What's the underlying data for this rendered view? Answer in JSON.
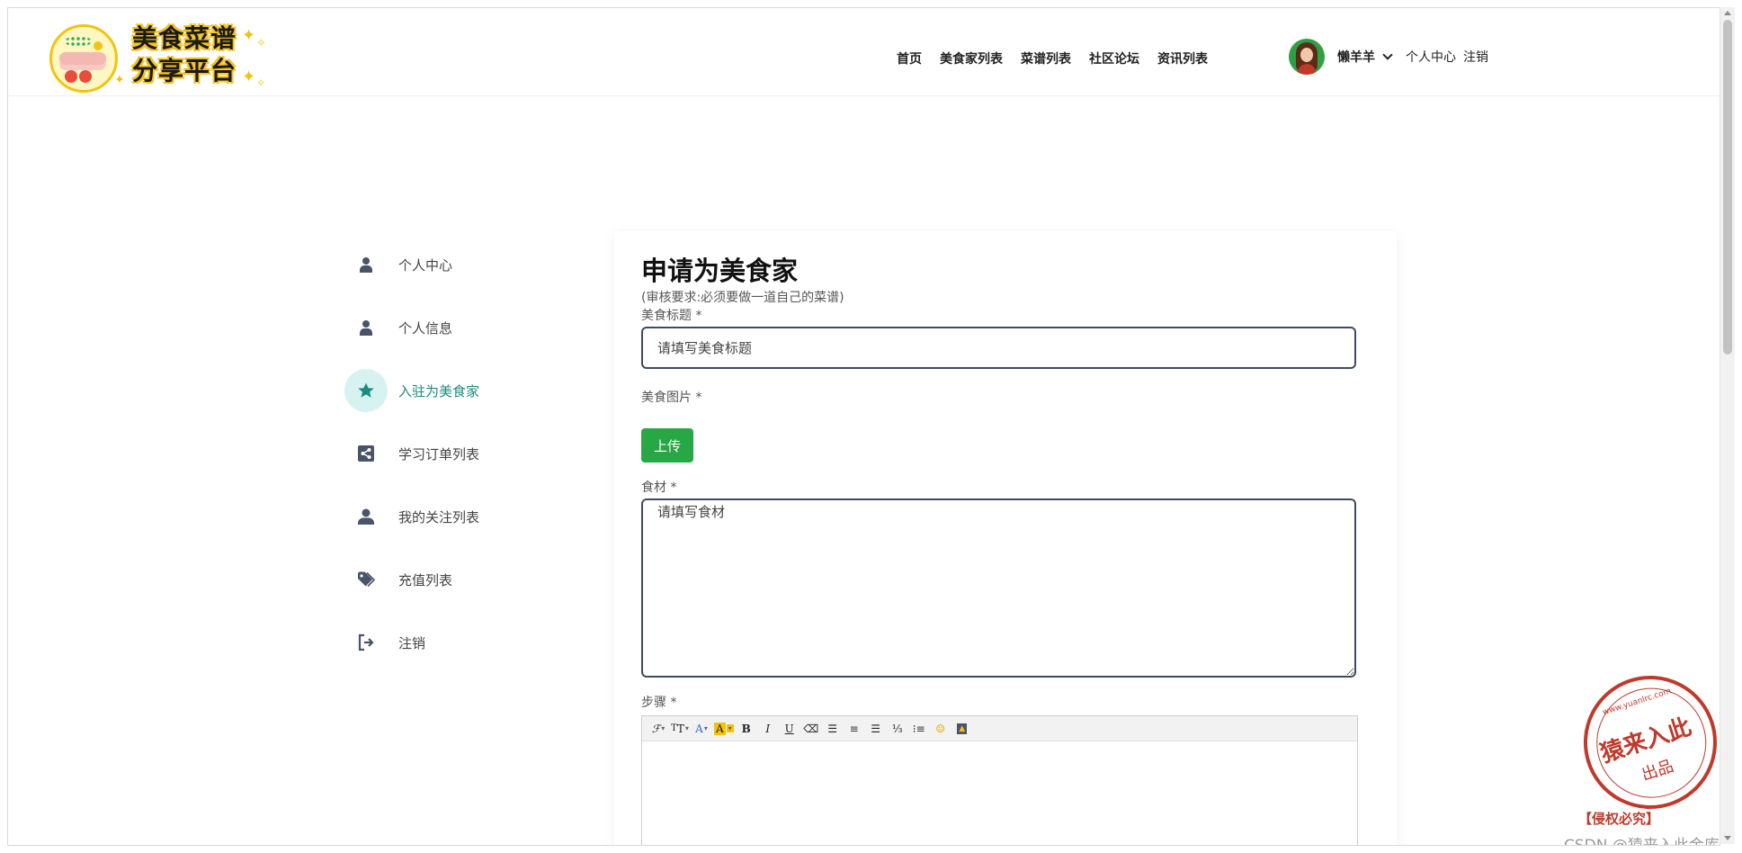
{
  "brand": {
    "line1": "美食菜谱",
    "line2": "分享平台"
  },
  "nav": [
    "首页",
    "美食家列表",
    "菜谱列表",
    "社区论坛",
    "资讯列表"
  ],
  "user": {
    "name": "懒羊羊",
    "center": "个人中心",
    "logout": "注销"
  },
  "sidebar": {
    "items": [
      {
        "label": "个人中心",
        "icon": "person-icon",
        "active": false
      },
      {
        "label": "个人信息",
        "icon": "person-icon",
        "active": false
      },
      {
        "label": "入驻为美食家",
        "icon": "star-icon",
        "active": true
      },
      {
        "label": "学习订单列表",
        "icon": "share-icon",
        "active": false
      },
      {
        "label": "我的关注列表",
        "icon": "person-icon",
        "active": false
      },
      {
        "label": "充值列表",
        "icon": "tag-icon",
        "active": false
      },
      {
        "label": "注销",
        "icon": "logout-icon",
        "active": false
      }
    ]
  },
  "form": {
    "title": "申请为美食家",
    "note": "(审核要求:必须要做一道自己的菜谱)",
    "food_title_label": "美食标题 *",
    "food_title_placeholder": "请填写美食标题",
    "food_image_label": "美食图片 *",
    "upload_label": "上传",
    "ingredients_label": "食材 *",
    "ingredients_placeholder": "请填写食材",
    "steps_label": "步骤 *"
  },
  "editor_tools": [
    "font-family-icon",
    "font-size-icon",
    "font-color-icon",
    "background-color-icon",
    "bold-icon",
    "italic-icon",
    "underline-icon",
    "eraser-icon",
    "align-left-icon",
    "align-center-icon",
    "align-right-icon",
    "ordered-list-icon",
    "unordered-list-icon",
    "emoji-icon",
    "image-icon"
  ],
  "watermark": {
    "stamp_url": "www.yuanlrc.com",
    "stamp_main": "猿来入此",
    "stamp_sub": "出品",
    "stamp_footer": "【侵权必究】",
    "csdn": "CSDN @猿来入此金库"
  },
  "colors": {
    "accent": "#1d8a80",
    "active_bg": "#d6f3f1",
    "upload": "#28a745",
    "input_border": "#3d4a63"
  }
}
